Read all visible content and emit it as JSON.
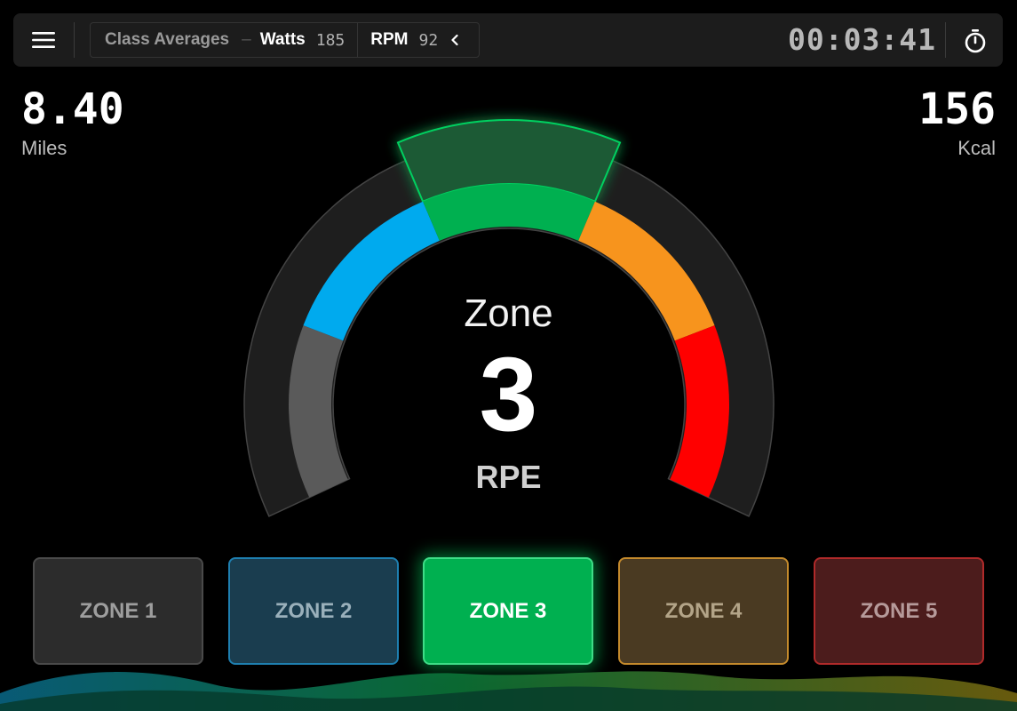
{
  "header": {
    "averages_title": "Class Averages",
    "averages_separator": "–",
    "watts_label": "Watts",
    "watts_value": "185",
    "rpm_label": "RPM",
    "rpm_value": "92",
    "timer": "00:03:41"
  },
  "stats": {
    "distance_value": "8.40",
    "distance_unit": "Miles",
    "calories_value": "156",
    "calories_unit": "Kcal"
  },
  "gauge": {
    "title": "Zone",
    "current_zone": "3",
    "subtitle": "RPE",
    "active_zone_index": 3
  },
  "zones": [
    {
      "label": "ZONE 1",
      "color": "#5a5a5a"
    },
    {
      "label": "ZONE 2",
      "color": "#00aaee"
    },
    {
      "label": "ZONE 3",
      "color": "#00b050"
    },
    {
      "label": "ZONE 4",
      "color": "#f7941d"
    },
    {
      "label": "ZONE 5",
      "color": "#ff0000"
    }
  ],
  "colors": {
    "active_accent": "#00c853",
    "topbar_bg": "#1c1c1c"
  }
}
